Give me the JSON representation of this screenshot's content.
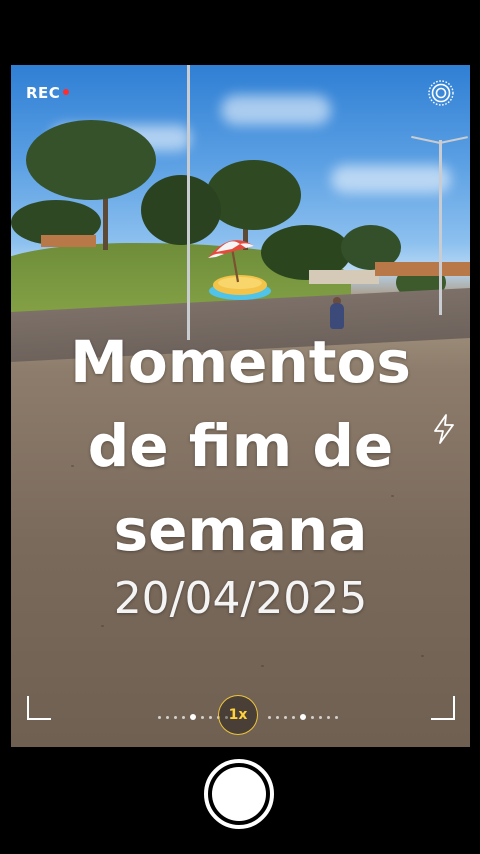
{
  "status": {
    "rec_label": "REC",
    "rec_color": "#ff2d2d"
  },
  "overlay": {
    "title_lines": [
      "Momentos",
      "de fim de",
      "semana"
    ],
    "date": "20/04/2025",
    "sticker": "beach-umbrella-island-sticker"
  },
  "controls": {
    "zoom_label": "1x",
    "zoom_accent": "#ffd23c",
    "live_icon": "live-photo-icon",
    "flash_icon": "flash-icon",
    "shutter": "shutter-button"
  }
}
